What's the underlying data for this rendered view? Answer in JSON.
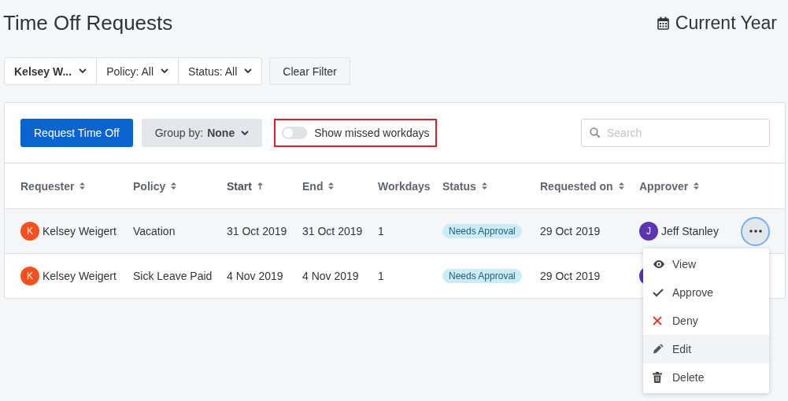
{
  "page": {
    "title": "Time Off Requests",
    "period": "Current Year"
  },
  "filters": [
    {
      "label": "Kelsey W...",
      "bold": true
    },
    {
      "label": "Policy: All",
      "bold": false
    },
    {
      "label": "Status: All",
      "bold": false
    }
  ],
  "clear_filter": "Clear Filter",
  "toolbar": {
    "primary_button": "Request Time Off",
    "group_by": {
      "label": "Group by:",
      "value": "None"
    },
    "toggle": {
      "label": "Show missed workdays",
      "on": false,
      "highlighted": true
    },
    "search": {
      "placeholder": "Search"
    }
  },
  "table": {
    "columns": [
      {
        "label": "Requester",
        "sortable": true,
        "sorted": false
      },
      {
        "label": "Policy",
        "sortable": true,
        "sorted": false
      },
      {
        "label": "Start",
        "sortable": true,
        "sorted": true
      },
      {
        "label": "End",
        "sortable": true,
        "sorted": false
      },
      {
        "label": "Workdays",
        "sortable": false,
        "sorted": false
      },
      {
        "label": "Status",
        "sortable": true,
        "sorted": false
      },
      {
        "label": "Requested on",
        "sortable": true,
        "sorted": false
      },
      {
        "label": "Approver",
        "sortable": true,
        "sorted": false
      }
    ],
    "rows": [
      {
        "requester": {
          "initial": "K",
          "name": "Kelsey Weigert",
          "color": "#f4511e"
        },
        "policy": "Vacation",
        "start": "31 Oct 2019",
        "end": "31 Oct 2019",
        "workdays": "1",
        "status": "Needs Approval",
        "requested_on": "29 Oct 2019",
        "approver": {
          "initial": "J",
          "name": "Jeff Stanley",
          "color": "#5e35b1"
        },
        "highlighted": true
      },
      {
        "requester": {
          "initial": "K",
          "name": "Kelsey Weigert",
          "color": "#f4511e"
        },
        "policy": "Sick Leave Paid",
        "start": "4 Nov 2019",
        "end": "4 Nov 2019",
        "workdays": "1",
        "status": "Needs Approval",
        "requested_on": "29 Oct 2019",
        "approver": {
          "color": "#5e35b1"
        },
        "highlighted": false
      }
    ]
  },
  "menu": {
    "items": [
      {
        "kind": "view",
        "label": "View",
        "highlighted": false
      },
      {
        "kind": "approve",
        "label": "Approve",
        "highlighted": false
      },
      {
        "kind": "deny",
        "label": "Deny",
        "highlighted": false
      },
      {
        "kind": "edit",
        "label": "Edit",
        "highlighted": true
      },
      {
        "kind": "delete",
        "label": "Delete",
        "highlighted": false
      }
    ]
  }
}
